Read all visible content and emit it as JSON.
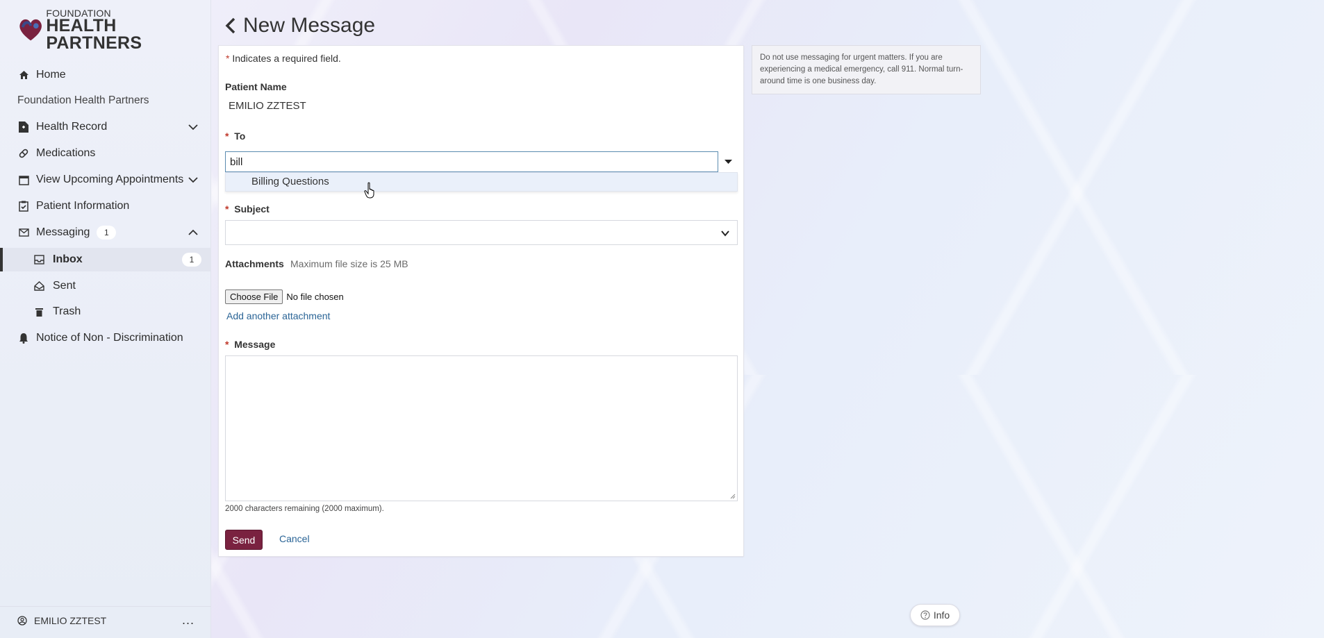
{
  "brand": {
    "top": "FOUNDATION",
    "bottom": "HEALTH PARTNERS",
    "color": "#7a2240"
  },
  "sidebar": {
    "items": [
      {
        "label": "Home",
        "icon": "home-icon"
      },
      {
        "label": "Foundation Health Partners"
      },
      {
        "label": "Health Record",
        "icon": "file-medical-icon"
      },
      {
        "label": "Medications",
        "icon": "pill-icon"
      },
      {
        "label": "View Upcoming Appointments",
        "icon": "calendar-icon"
      },
      {
        "label": "Patient Information",
        "icon": "clipboard-check-icon"
      },
      {
        "label": "Messaging",
        "icon": "envelope-icon",
        "badge": "1"
      },
      {
        "label": "Inbox",
        "icon": "inbox-icon",
        "badge": "1"
      },
      {
        "label": "Sent",
        "icon": "sent-icon"
      },
      {
        "label": "Trash",
        "icon": "trash-icon"
      },
      {
        "label": "Notice of Non - Discrimination",
        "icon": "bell-icon"
      }
    ],
    "user": {
      "name": "EMILIO ZZTEST",
      "menu": "..."
    }
  },
  "header": {
    "title": "New Message"
  },
  "form": {
    "required_marker": "*",
    "required_note": "Indicates a required field.",
    "patient_label": "Patient Name",
    "patient_value": "EMILIO ZZTEST",
    "to_label": "To",
    "to_value": "bill",
    "to_options": [
      "Billing Questions"
    ],
    "subject_label": "Subject",
    "subject_value": "",
    "attachments_label": "Attachments",
    "attachments_hint": "Maximum file size is 25 MB",
    "choose_file_label": "Choose File",
    "file_status": "No file chosen",
    "add_attachment": "Add another attachment",
    "message_label": "Message",
    "message_value": "",
    "char_count": "2000 characters remaining (2000 maximum).",
    "send_label": "Send",
    "cancel_label": "Cancel"
  },
  "notice": {
    "text": "Do not use messaging for urgent matters. If you are experiencing a medical emergency, call 911. Normal turn-around time is one business day."
  },
  "info_button": {
    "label": "Info"
  }
}
